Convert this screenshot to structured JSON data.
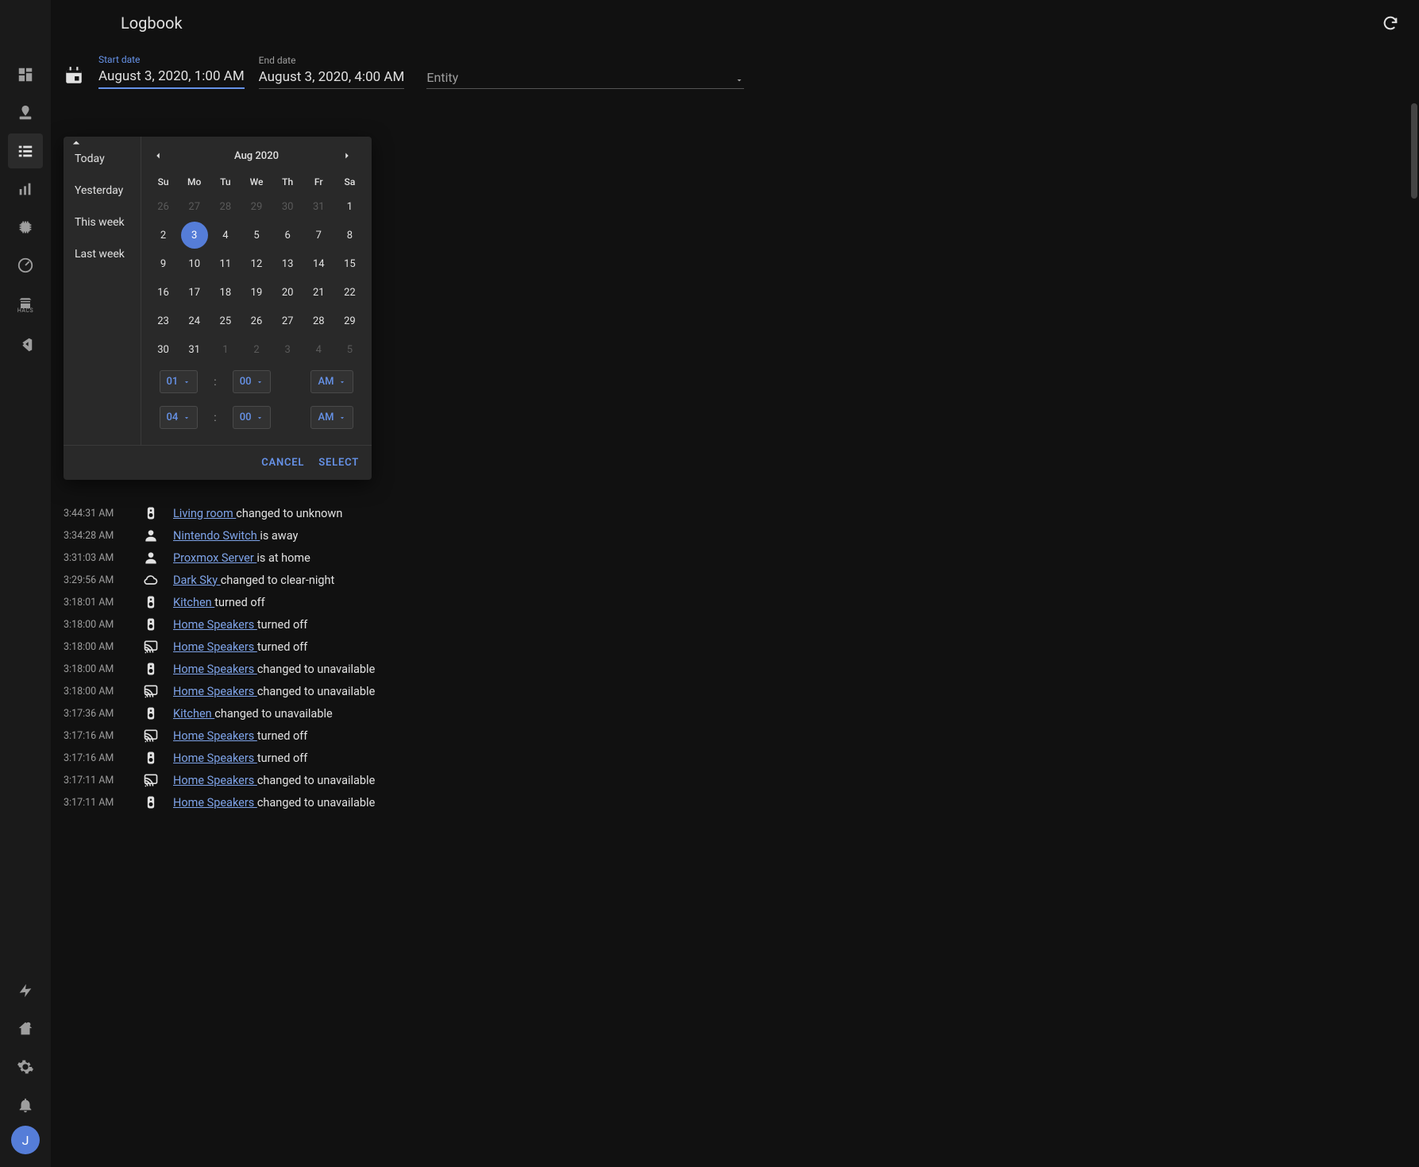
{
  "header": {
    "title": "Logbook"
  },
  "filters": {
    "start_label": "Start date",
    "start_value": "August 3, 2020, 1:00 AM",
    "end_label": "End date",
    "end_value": "August 3, 2020, 4:00 AM",
    "entity_placeholder": "Entity"
  },
  "picker": {
    "presets": [
      "Today",
      "Yesterday",
      "This week",
      "Last week"
    ],
    "month_label": "Aug 2020",
    "weekdays": [
      "Su",
      "Mo",
      "Tu",
      "We",
      "Th",
      "Fr",
      "Sa"
    ],
    "grid": [
      [
        {
          "d": "26",
          "dim": true
        },
        {
          "d": "27",
          "dim": true
        },
        {
          "d": "28",
          "dim": true
        },
        {
          "d": "29",
          "dim": true
        },
        {
          "d": "30",
          "dim": true
        },
        {
          "d": "31",
          "dim": true
        },
        {
          "d": "1"
        }
      ],
      [
        {
          "d": "2"
        },
        {
          "d": "3",
          "sel": true
        },
        {
          "d": "4"
        },
        {
          "d": "5"
        },
        {
          "d": "6"
        },
        {
          "d": "7"
        },
        {
          "d": "8"
        }
      ],
      [
        {
          "d": "9"
        },
        {
          "d": "10"
        },
        {
          "d": "11"
        },
        {
          "d": "12"
        },
        {
          "d": "13"
        },
        {
          "d": "14"
        },
        {
          "d": "15"
        }
      ],
      [
        {
          "d": "16"
        },
        {
          "d": "17"
        },
        {
          "d": "18"
        },
        {
          "d": "19"
        },
        {
          "d": "20"
        },
        {
          "d": "21"
        },
        {
          "d": "22"
        }
      ],
      [
        {
          "d": "23"
        },
        {
          "d": "24"
        },
        {
          "d": "25"
        },
        {
          "d": "26"
        },
        {
          "d": "27"
        },
        {
          "d": "28"
        },
        {
          "d": "29"
        }
      ],
      [
        {
          "d": "30"
        },
        {
          "d": "31"
        },
        {
          "d": "1",
          "dim": true
        },
        {
          "d": "2",
          "dim": true
        },
        {
          "d": "3",
          "dim": true
        },
        {
          "d": "4",
          "dim": true
        },
        {
          "d": "5",
          "dim": true
        }
      ]
    ],
    "time_start": {
      "hour": "01",
      "minute": "00",
      "ampm": "AM"
    },
    "time_end": {
      "hour": "04",
      "minute": "00",
      "ampm": "AM"
    },
    "cancel": "CANCEL",
    "select": "SELECT"
  },
  "sidebar": {
    "avatar_initial": "J"
  },
  "log": [
    {
      "time": "3:44:31 AM",
      "icon": "speaker",
      "entity": "Living room",
      "tail": "changed to unknown"
    },
    {
      "time": "3:34:28 AM",
      "icon": "person",
      "entity": "Nintendo Switch",
      "tail": "is away"
    },
    {
      "time": "3:31:03 AM",
      "icon": "person",
      "entity": "Proxmox Server",
      "tail": "is at home"
    },
    {
      "time": "3:29:56 AM",
      "icon": "cloud",
      "entity": "Dark Sky",
      "tail": "changed to clear-night"
    },
    {
      "time": "3:18:01 AM",
      "icon": "speaker",
      "entity": "Kitchen",
      "tail": "turned off"
    },
    {
      "time": "3:18:00 AM",
      "icon": "speaker",
      "entity": "Home Speakers",
      "tail": "turned off"
    },
    {
      "time": "3:18:00 AM",
      "icon": "cast",
      "entity": "Home Speakers",
      "tail": "turned off"
    },
    {
      "time": "3:18:00 AM",
      "icon": "speaker",
      "entity": "Home Speakers",
      "tail": "changed to unavailable"
    },
    {
      "time": "3:18:00 AM",
      "icon": "cast",
      "entity": "Home Speakers",
      "tail": "changed to unavailable"
    },
    {
      "time": "3:17:36 AM",
      "icon": "speaker",
      "entity": "Kitchen",
      "tail": "changed to unavailable"
    },
    {
      "time": "3:17:16 AM",
      "icon": "cast",
      "entity": "Home Speakers",
      "tail": "turned off"
    },
    {
      "time": "3:17:16 AM",
      "icon": "speaker",
      "entity": "Home Speakers",
      "tail": "turned off"
    },
    {
      "time": "3:17:11 AM",
      "icon": "cast",
      "entity": "Home Speakers",
      "tail": "changed to unavailable"
    },
    {
      "time": "3:17:11 AM",
      "icon": "speaker",
      "entity": "Home Speakers",
      "tail": "changed to unavailable"
    }
  ]
}
